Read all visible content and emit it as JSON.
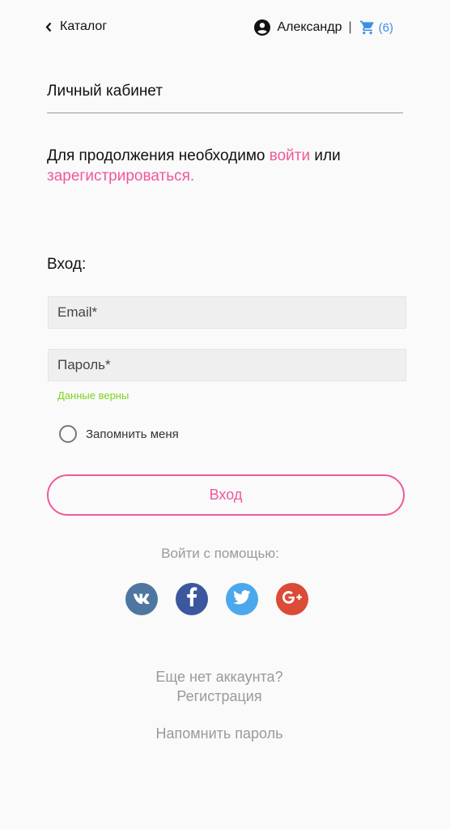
{
  "header": {
    "back_label": "Каталог",
    "user_name": "Александр",
    "separator": "|",
    "cart_count": "(6)"
  },
  "page": {
    "title": "Личный кабинет",
    "notice_prefix": "Для продолжения необходимо ",
    "notice_login_link": "войти",
    "notice_middle": " или",
    "notice_register_link": "зарегистрироваться."
  },
  "login": {
    "heading": "Вход:",
    "email_placeholder": "Email*",
    "password_placeholder": "Пароль*",
    "validation_hint": "Данные верны",
    "remember_label": "Запомнить меня",
    "submit_label": "Вход"
  },
  "social": {
    "label": "Войти с помощью:",
    "providers": [
      {
        "name": "vk",
        "glyph": "vk",
        "color": "#4f76a1"
      },
      {
        "name": "facebook",
        "glyph": "f",
        "color": "#3b579d"
      },
      {
        "name": "twitter",
        "glyph": "bird",
        "color": "#4ca8ec"
      },
      {
        "name": "google-plus",
        "glyph": "G+",
        "color": "#dc4a38"
      }
    ]
  },
  "footer": {
    "no_account": "Еще нет аккаунта?",
    "register_link": "Регистрация",
    "remind_password": "Напомнить пароль"
  },
  "colors": {
    "accent": "#f0589a",
    "cart": "#3a8ee6",
    "success": "#7ed321",
    "muted": "#9a9a9a"
  }
}
